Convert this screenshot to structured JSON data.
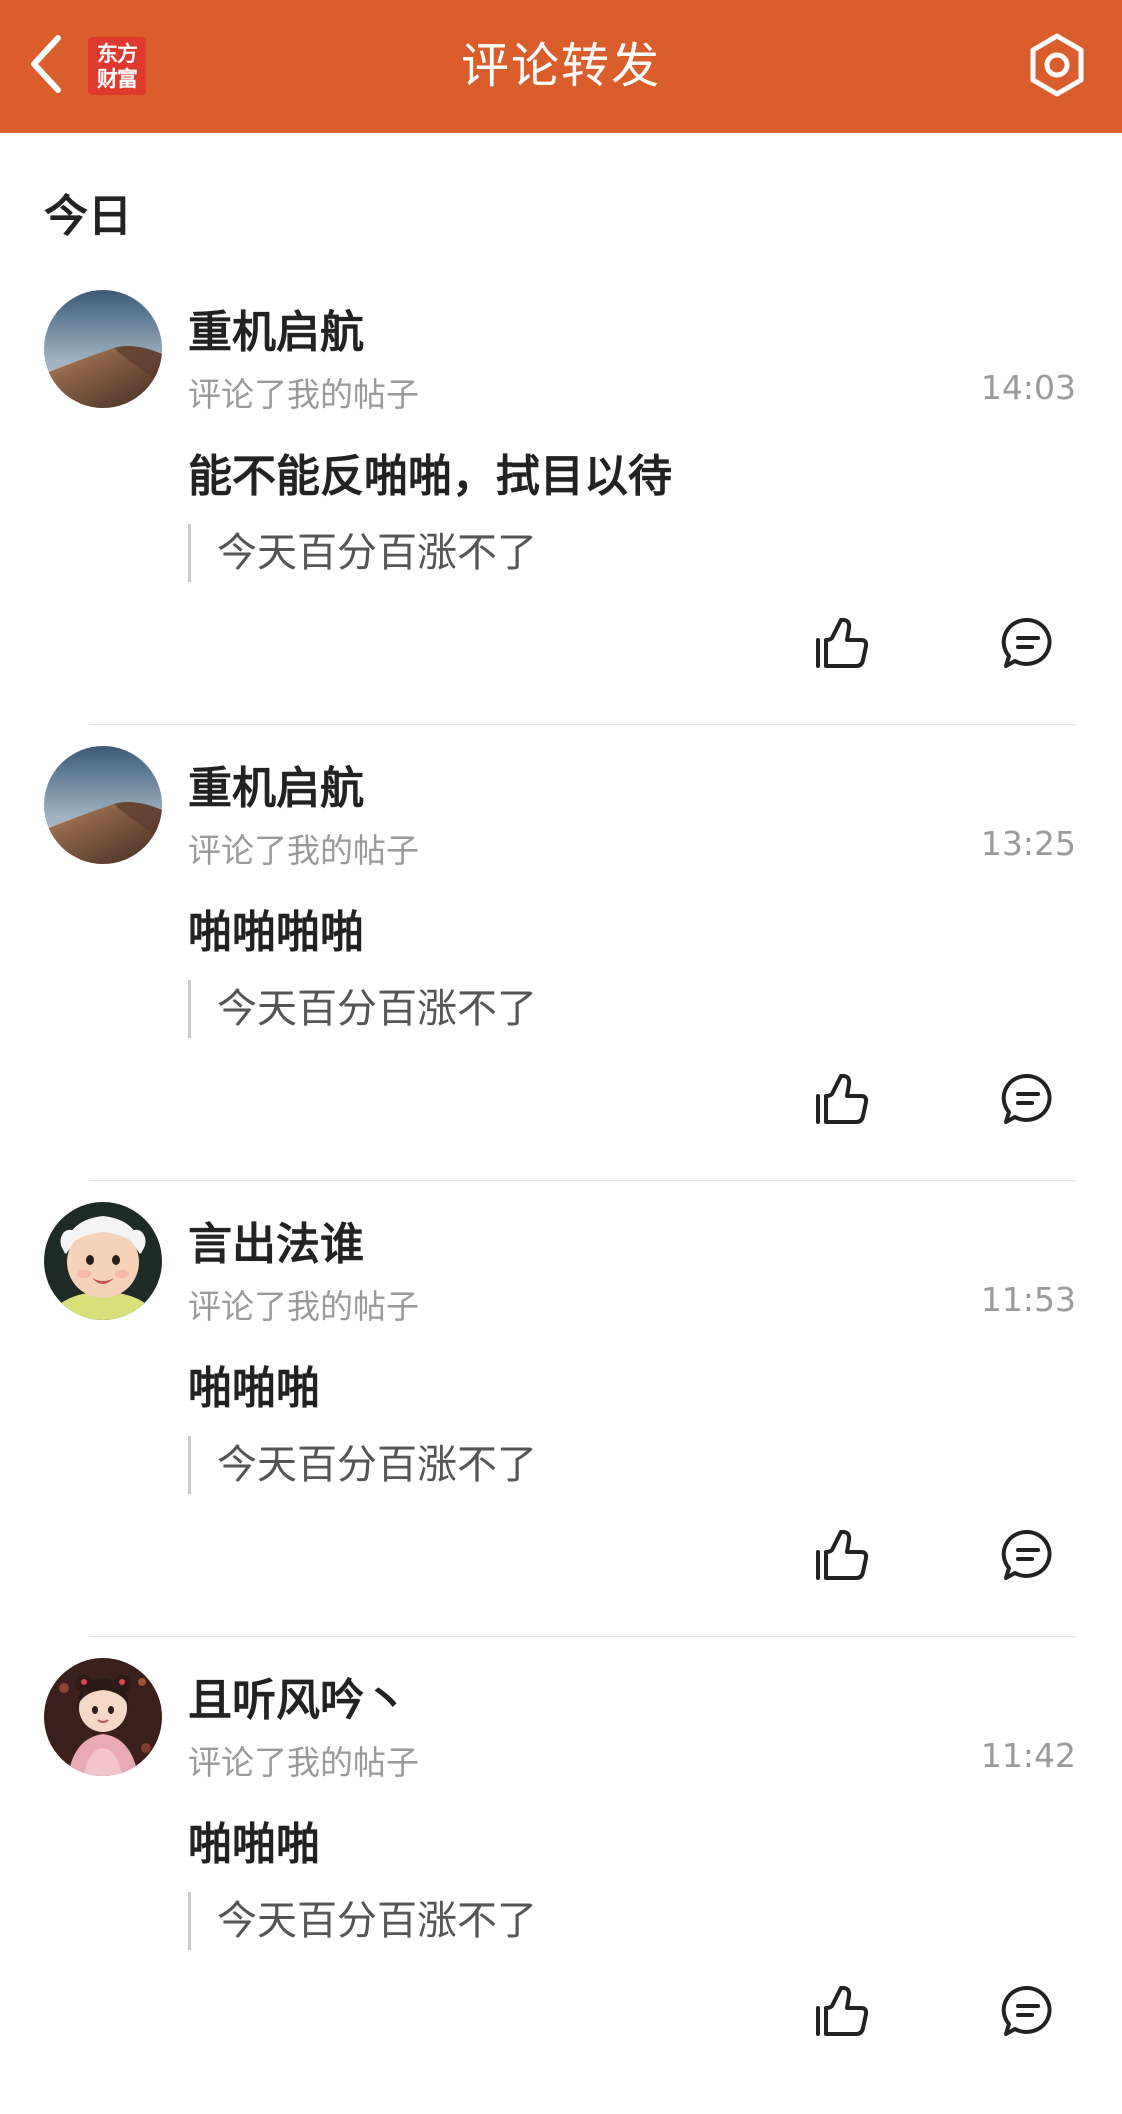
{
  "header": {
    "title": "评论转发",
    "logo_line1": "东方",
    "logo_line2": "财富"
  },
  "section_label": "今日",
  "items": [
    {
      "username": "重机启航",
      "action": "评论了我的帖子",
      "time": "14:03",
      "comment": "能不能反啪啪，拭目以待",
      "quote": "今天百分百涨不了",
      "avatar": "desert-dune"
    },
    {
      "username": "重机启航",
      "action": "评论了我的帖子",
      "time": "13:25",
      "comment": "啪啪啪啪",
      "quote": "今天百分百涨不了",
      "avatar": "desert-dune"
    },
    {
      "username": "言出法谁",
      "action": "评论了我的帖子",
      "time": "11:53",
      "comment": "啪啪啪",
      "quote": "今天百分百涨不了",
      "avatar": "baby-photo"
    },
    {
      "username": "且听风吟丶",
      "action": "评论了我的帖子",
      "time": "11:42",
      "comment": "啪啪啪",
      "quote": "今天百分百涨不了",
      "avatar": "girl-illustration"
    }
  ],
  "icons": {
    "back": "chevron-left-icon",
    "settings": "gear-icon",
    "like": "thumbs-up-icon",
    "reply": "comment-bubble-icon"
  },
  "colors": {
    "header_bg": "#d95e2c",
    "logo_bg": "#e03a2f",
    "primary_text": "#222222",
    "secondary_text": "#9a9a9a",
    "quote_text": "#555555",
    "divider": "#e4e4e4"
  }
}
